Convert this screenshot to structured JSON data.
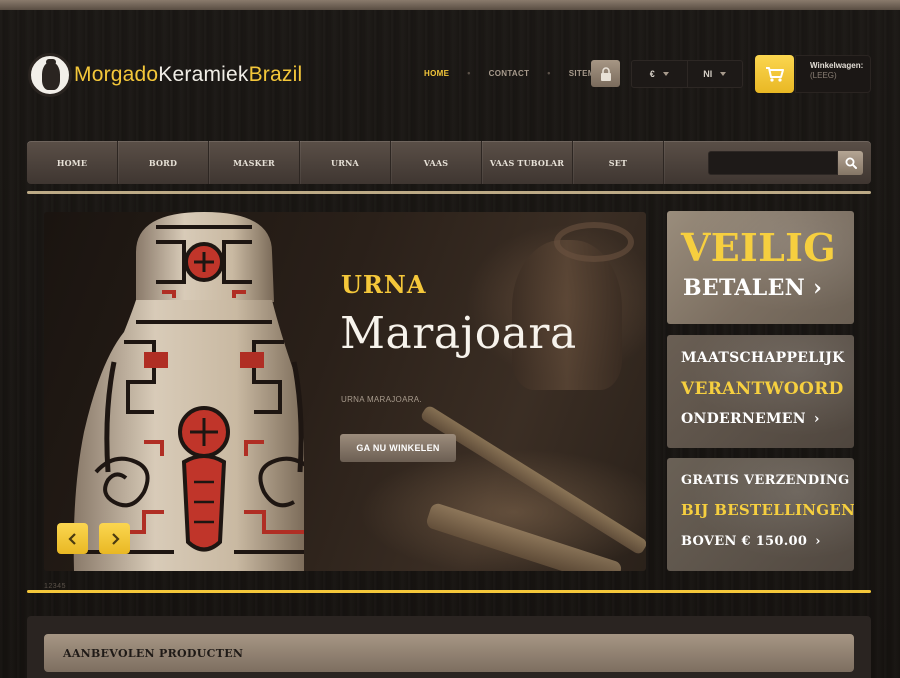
{
  "header": {
    "logo": {
      "part1": "Morgado",
      "part2": "Keramiek",
      "part3": "Brazil"
    },
    "links": [
      {
        "label": "HOME",
        "active": true
      },
      {
        "label": "CONTACT",
        "active": false
      },
      {
        "label": "SITEMAP",
        "active": false
      }
    ],
    "currency": "€",
    "language": "Nl",
    "cart": {
      "title": "Winkelwagen:",
      "status": "(LEEG)"
    }
  },
  "nav": {
    "items": [
      "HOME",
      "BORD",
      "MASKER",
      "URNA",
      "VAAS",
      "VAAS TUBOLAR",
      "SET"
    ],
    "search_placeholder": ""
  },
  "slider": {
    "kicker": "URNA",
    "title": "Marajoara",
    "subtitle": "URNA MARAJOARA.",
    "button": "GA NU WINKELEN",
    "pager": "12345"
  },
  "promos": [
    {
      "line1": "VEILIG",
      "line2": "BETALEN"
    },
    {
      "line1": "MAATSCHAPPELIJK",
      "line2": "VERANTWOORD",
      "line3": "ONDERNEMEN"
    },
    {
      "line1": "GRATIS VERZENDING",
      "line2": "BIJ BESTELLINGEN",
      "line3": "BOVEN € 150.00"
    }
  ],
  "featured": {
    "title": "AANBEVOLEN PRODUCTEN"
  },
  "colors": {
    "accent": "#f4c73a",
    "nav": "#4c423b",
    "background": "#17130f"
  },
  "icons": [
    "lock-icon",
    "cart-icon",
    "search-icon",
    "chevron-left-icon",
    "chevron-right-icon",
    "chevron-down-icon"
  ]
}
